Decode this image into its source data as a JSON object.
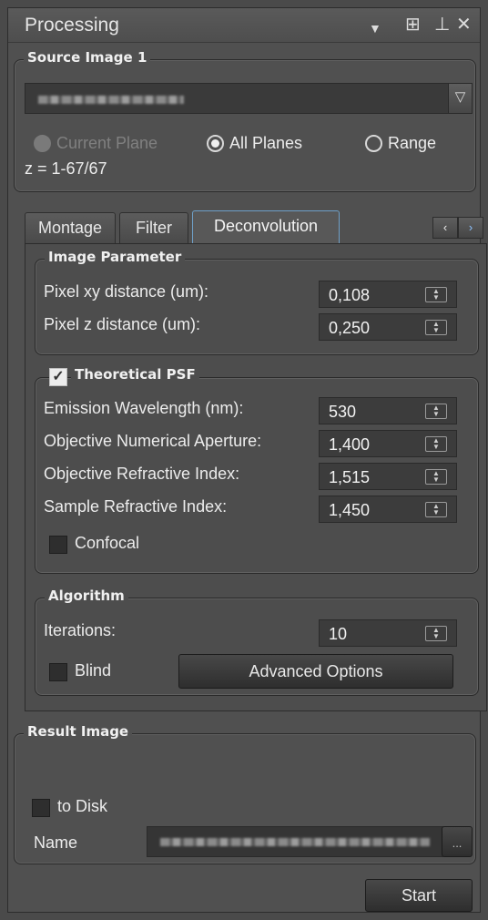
{
  "window": {
    "title": "Processing"
  },
  "source": {
    "legend": "Source Image 1",
    "planes": [
      {
        "label": "Current Plane",
        "selected": false,
        "enabled": false
      },
      {
        "label": "All Planes",
        "selected": true,
        "enabled": true
      },
      {
        "label": "Range",
        "selected": false,
        "enabled": true
      }
    ],
    "z_info": "z = 1-67/67"
  },
  "tabs": [
    {
      "label": "Montage",
      "active": false
    },
    {
      "label": "Filter",
      "active": false
    },
    {
      "label": "Deconvolution",
      "active": true
    }
  ],
  "image_parameter": {
    "legend": "Image Parameter",
    "rows": [
      {
        "label": "Pixel xy distance (um):",
        "value": "0,108"
      },
      {
        "label": "Pixel z distance (um):",
        "value": "0,250"
      }
    ]
  },
  "psf": {
    "legend": "Theoretical PSF",
    "checked": true,
    "rows": [
      {
        "label": "Emission Wavelength (nm):",
        "value": "530"
      },
      {
        "label": "Objective Numerical Aperture:",
        "value": "1,400"
      },
      {
        "label": "Objective Refractive Index:",
        "value": "1,515"
      },
      {
        "label": "Sample Refractive Index:",
        "value": "1,450"
      }
    ],
    "confocal_label": "Confocal",
    "confocal_checked": false
  },
  "algorithm": {
    "legend": "Algorithm",
    "iterations_label": "Iterations:",
    "iterations_value": "10",
    "blind_label": "Blind",
    "blind_checked": false,
    "advanced_label": "Advanced Options"
  },
  "result": {
    "legend": "Result Image",
    "to_disk_label": "to Disk",
    "to_disk_checked": false,
    "name_label": "Name",
    "browse_label": "..."
  },
  "start_label": "Start",
  "icons": [
    "dropdown-arrow-icon",
    "float-window-icon",
    "pin-icon",
    "close-icon",
    "combo-arrow-icon",
    "tab-prev-icon",
    "tab-next-icon",
    "spin-arrows-icon",
    "checkmark-icon"
  ]
}
